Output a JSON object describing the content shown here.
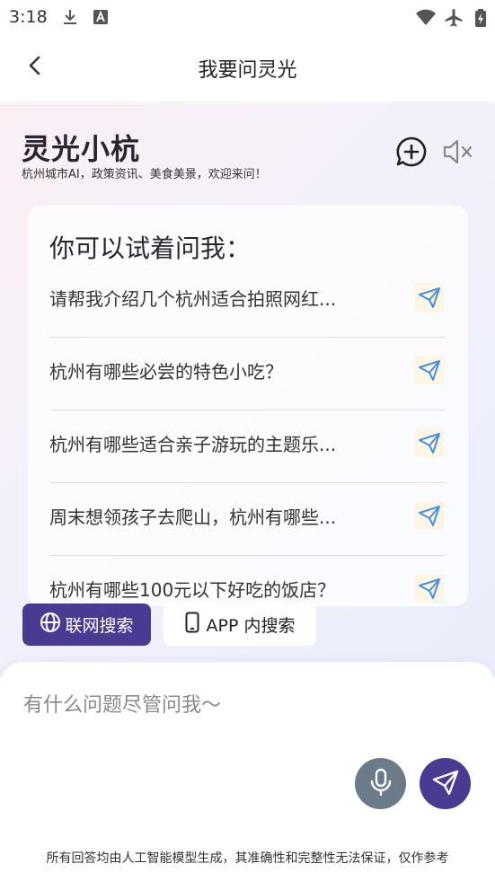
{
  "status_bar": {
    "time": "3:18",
    "icons": [
      "download-icon",
      "text-a-icon",
      "wifi-icon",
      "airplane-icon",
      "battery-charging-icon"
    ]
  },
  "header": {
    "title": "我要问灵光",
    "back_icon": "chevron-left-icon"
  },
  "brand": {
    "title": "灵光小杭",
    "subtitle": "杭州城市AI，政策资讯、美食美景，欢迎来问！",
    "new_chat_icon": "chat-plus-icon",
    "mute_icon": "speaker-mute-icon"
  },
  "suggestions": {
    "title": "你可以试着问我：",
    "items": [
      {
        "text": "请帮我介绍几个杭州适合拍照网红...",
        "icon": "paper-plane-icon"
      },
      {
        "text": "杭州有哪些必尝的特色小吃？",
        "icon": "paper-plane-icon"
      },
      {
        "text": "杭州有哪些适合亲子游玩的主题乐...",
        "icon": "paper-plane-icon"
      },
      {
        "text": "周末想领孩子去爬山，杭州有哪些...",
        "icon": "paper-plane-icon"
      },
      {
        "text": "杭州有哪些100元以下好吃的饭店？",
        "icon": "paper-plane-icon"
      }
    ]
  },
  "modes": {
    "web_label": "联网搜索",
    "app_label": "APP 内搜索",
    "web_icon": "globe-icon",
    "app_icon": "phone-icon",
    "selected": "web"
  },
  "input": {
    "placeholder": "有什么问题尽管问我～",
    "value": ""
  },
  "disclaimer": "所有回答均由人工智能模型生成，其准确性和完整性无法保证，仅作参考",
  "colors": {
    "accent": "#4b3a91",
    "mic": "#6c7b8a",
    "send_icon": "#4a90e2"
  }
}
